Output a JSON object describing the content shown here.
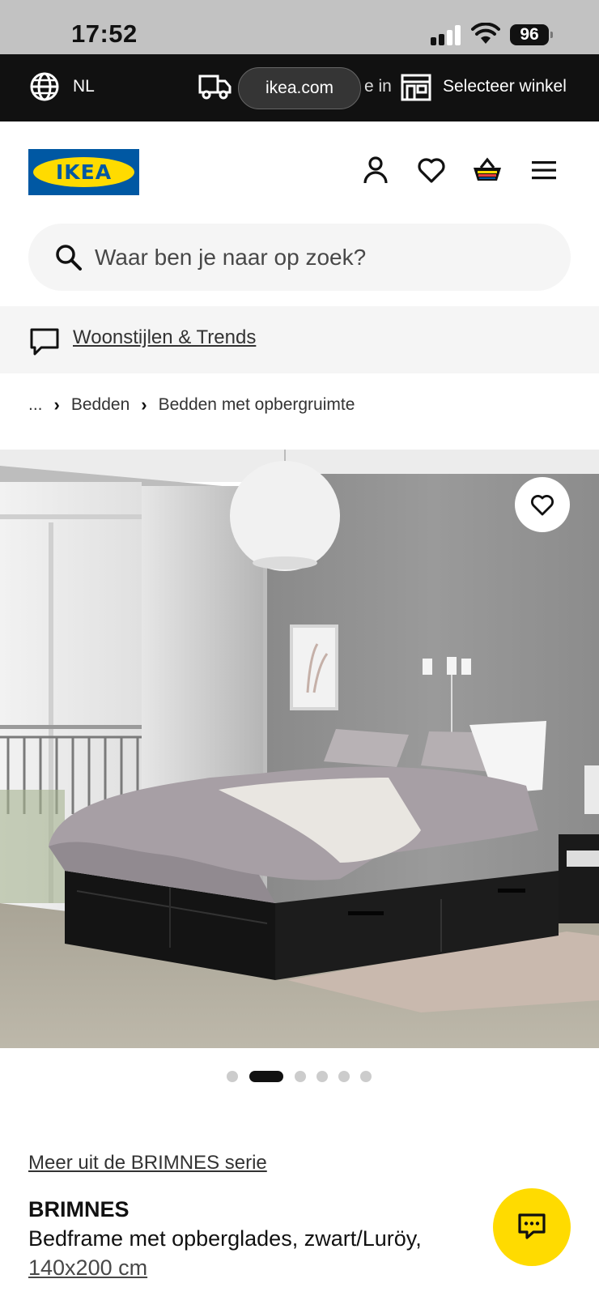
{
  "status_bar": {
    "time": "17:52",
    "battery": "96"
  },
  "topbar": {
    "language": "NL",
    "delivery_text": "e in",
    "url": "ikea.com",
    "store_label": "Selecteer winkel"
  },
  "header": {
    "logo_text": "IKEA",
    "search_placeholder": "Waar ben je naar op zoek?"
  },
  "trends": {
    "label": "Woonstijlen & Trends"
  },
  "breadcrumb": {
    "items": [
      "...",
      "Bedden",
      "Bedden met opbergruimte"
    ]
  },
  "carousel": {
    "total": 6,
    "active_index": 1
  },
  "product": {
    "series_link": "Meer uit de BRIMNES serie",
    "name": "BRIMNES",
    "description": "Bedframe met opberglades, zwart/Luröy,",
    "size": "140x200 cm"
  },
  "colors": {
    "ikea_blue": "#0058a3",
    "ikea_yellow": "#ffdb00",
    "topbar_bg": "#111111"
  },
  "icons": [
    "globe-icon",
    "truck-icon",
    "store-icon",
    "account-icon",
    "heart-icon",
    "basket-icon",
    "menu-icon",
    "search-icon",
    "speech-bubble-icon",
    "chat-icon"
  ]
}
